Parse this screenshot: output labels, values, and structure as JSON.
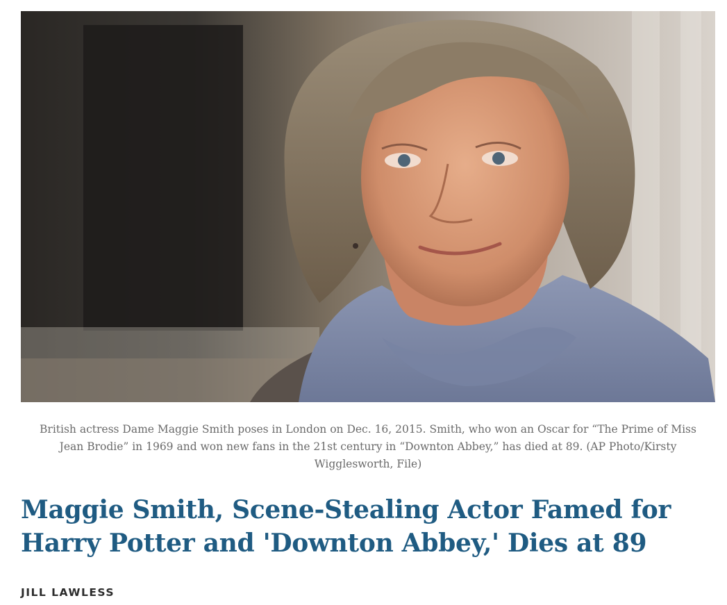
{
  "article": {
    "image_alt": "British actress Dame Maggie Smith",
    "caption": "British actress Dame Maggie Smith poses in London on Dec. 16, 2015. Smith, who won an Oscar for “The Prime of Miss Jean Brodie” in 1969 and won new fans in the 21st century in “Downton Abbey,” has died at 89. (AP Photo/Kirsty Wigglesworth, File)",
    "headline": "Maggie Smith, Scene-Stealing Actor Famed for Harry Potter and 'Downton Abbey,' Dies at 89",
    "byline": "JILL LAWLESS"
  },
  "colors": {
    "headline": "#1f5b82",
    "caption": "#6a6a6a",
    "byline": "#2b2b2b"
  }
}
